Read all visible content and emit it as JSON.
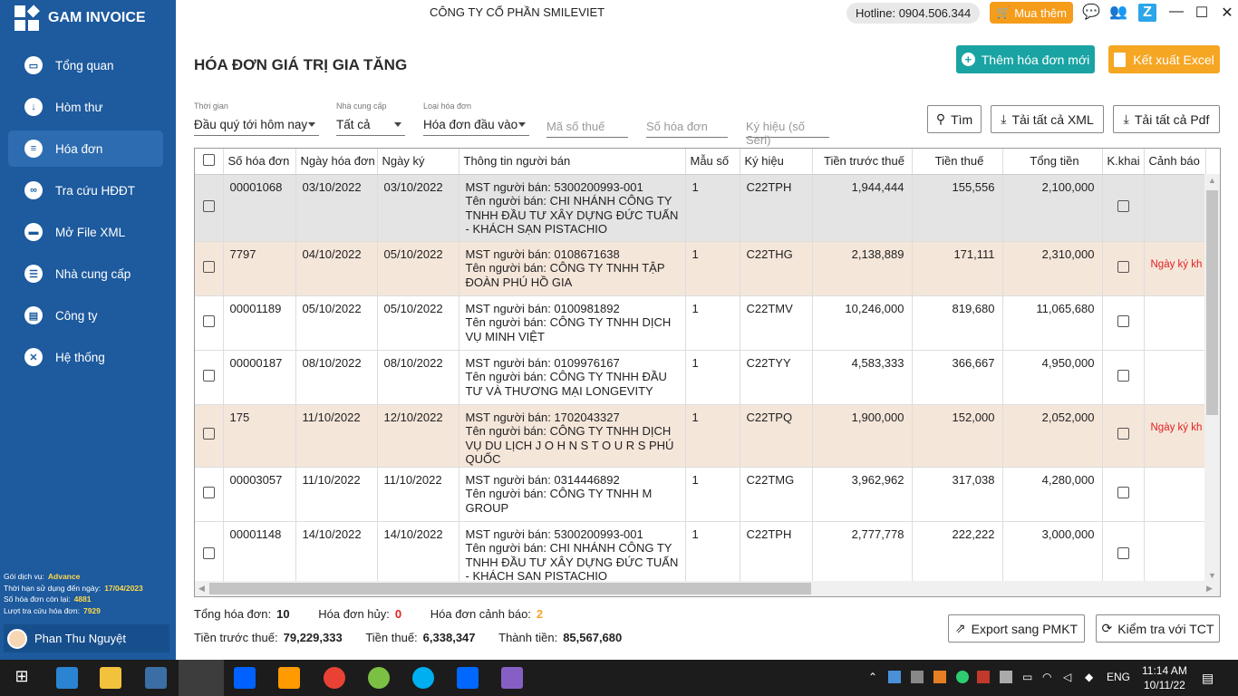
{
  "app": {
    "name": "GAM INVOICE",
    "company": "CÔNG TY CỔ PHẦN SMILEVIET",
    "hotline": "Hotline: 0904.506.344",
    "buy_label": "Mua thêm"
  },
  "nav": [
    {
      "label": "Tổng quan",
      "icon": "monitor-icon"
    },
    {
      "label": "Hòm thư",
      "icon": "download-icon"
    },
    {
      "label": "Hóa đơn",
      "icon": "document-icon"
    },
    {
      "label": "Tra cứu HĐĐT",
      "icon": "link-icon"
    },
    {
      "label": "Mở File XML",
      "icon": "folder-icon"
    },
    {
      "label": "Nhà cung cấp",
      "icon": "contacts-icon"
    },
    {
      "label": "Công ty",
      "icon": "building-icon"
    },
    {
      "label": "Hệ thống",
      "icon": "tools-icon"
    }
  ],
  "service": {
    "plan_label": "Gói dịch vụ:",
    "plan": "Advance",
    "expiry_label": "Thời hạn sử dụng đến ngày:",
    "expiry": "17/04/2023",
    "remaining_label": "Số hóa đơn còn lại:",
    "remaining": "4881",
    "lookups_label": "Lượt tra cứu hóa đơn:",
    "lookups": "7929"
  },
  "user": {
    "name": "Phan Thu Nguyệt"
  },
  "page": {
    "title": "HÓA ĐƠN GIÁ TRỊ GIA TĂNG",
    "add_label": "Thêm hóa đơn mới",
    "export_label": "Kết xuất Excel"
  },
  "filters": {
    "period_label": "Thời gian",
    "period": "Đầu quý tới hôm nay",
    "supplier_label": "Nhà cung cấp",
    "supplier": "Tất cả",
    "type_label": "Loại hóa đơn",
    "type": "Hóa đơn đầu vào",
    "tax_placeholder": "Mã số thuế",
    "number_placeholder": "Số hóa đơn",
    "serial_placeholder": "Ký hiệu (số Seri)",
    "search_label": "Tìm",
    "xml_label": "Tải tất cả XML",
    "pdf_label": "Tải tất cả Pdf"
  },
  "columns": [
    "Số hóa đơn",
    "Ngày hóa đơn",
    "Ngày ký",
    "Thông tin người bán",
    "Mẫu số",
    "Ký hiệu",
    "Tiền trước thuế",
    "Tiền thuế",
    "Tổng tiền",
    "K.khai",
    "Cảnh báo"
  ],
  "rows": [
    {
      "no": "00001068",
      "date": "03/10/2022",
      "signed": "03/10/2022",
      "mst": "MST người bán: 5300200993-001",
      "seller": "Tên người bán: CHI NHÁNH CÔNG TY TNHH ĐẦU TƯ XÂY DỰNG ĐỨC TUẤN - KHÁCH SẠN PISTACHIO",
      "form": "1",
      "serial": "C22TPH",
      "pre": "1,944,444",
      "tax": "155,556",
      "total": "2,100,000",
      "warn": ""
    },
    {
      "no": "7797",
      "date": "04/10/2022",
      "signed": "05/10/2022",
      "mst": "MST người bán: 0108671638",
      "seller": "Tên người bán: CÔNG TY TNHH TẬP ĐOÀN PHÚ HỒ GIA",
      "form": "1",
      "serial": "C22THG",
      "pre": "2,138,889",
      "tax": "171,111",
      "total": "2,310,000",
      "warn": "Ngày ký kh"
    },
    {
      "no": "00001189",
      "date": "05/10/2022",
      "signed": "05/10/2022",
      "mst": "MST người bán: 0100981892",
      "seller": "Tên người bán: CÔNG TY TNHH DỊCH VỤ MINH VIỆT",
      "form": "1",
      "serial": "C22TMV",
      "pre": "10,246,000",
      "tax": "819,680",
      "total": "11,065,680",
      "warn": ""
    },
    {
      "no": "00000187",
      "date": "08/10/2022",
      "signed": "08/10/2022",
      "mst": "MST người bán: 0109976167",
      "seller": "Tên người bán: CÔNG TY TNHH ĐẦU TƯ VÀ THƯƠNG MẠI LONGEVITY",
      "form": "1",
      "serial": "C22TYY",
      "pre": "4,583,333",
      "tax": "366,667",
      "total": "4,950,000",
      "warn": ""
    },
    {
      "no": "175",
      "date": "11/10/2022",
      "signed": "12/10/2022",
      "mst": "MST người bán: 1702043327",
      "seller": "Tên người bán: CÔNG TY TNHH DỊCH VỤ DU LỊCH J O H N S T O U R S PHÚ QUỐC",
      "form": "1",
      "serial": "C22TPQ",
      "pre": "1,900,000",
      "tax": "152,000",
      "total": "2,052,000",
      "warn": "Ngày ký kh"
    },
    {
      "no": "00003057",
      "date": "11/10/2022",
      "signed": "11/10/2022",
      "mst": "MST người bán: 0314446892",
      "seller": "Tên người bán: CÔNG TY TNHH M GROUP",
      "form": "1",
      "serial": "C22TMG",
      "pre": "3,962,962",
      "tax": "317,038",
      "total": "4,280,000",
      "warn": ""
    },
    {
      "no": "00001148",
      "date": "14/10/2022",
      "signed": "14/10/2022",
      "mst": "MST người bán: 5300200993-001",
      "seller": "Tên người bán: CHI NHÁNH CÔNG TY TNHH ĐẦU TƯ XÂY DỰNG ĐỨC TUẤN - KHÁCH SẠN PISTACHIO",
      "form": "1",
      "serial": "C22TPH",
      "pre": "2,777,778",
      "tax": "222,222",
      "total": "3,000,000",
      "warn": ""
    }
  ],
  "summary": {
    "total_label": "Tổng hóa đơn:",
    "total": "10",
    "cancel_label": "Hóa đơn hủy:",
    "cancel": "0",
    "warn_label": "Hóa đơn cảnh báo:",
    "warn": "2",
    "pre_label": "Tiền trước thuế:",
    "pre": "79,229,333",
    "tax_label": "Tiền thuế:",
    "tax": "6,338,347",
    "grand_label": "Thành tiền:",
    "grand": "85,567,680"
  },
  "actions": {
    "pmkt_label": "Export sang PMKT",
    "tct_label": "Kiểm tra với TCT"
  },
  "taskbar": {
    "lang": "ENG",
    "time": "11:14 AM",
    "date": "10/11/22"
  },
  "colors": {
    "sidebar": "#1d5a9e",
    "green": "#1aa3a3",
    "orange": "#f5a623",
    "selected": "#e4e4e4",
    "warn_row": "#f5e6da",
    "warn_text": "#e02020"
  }
}
